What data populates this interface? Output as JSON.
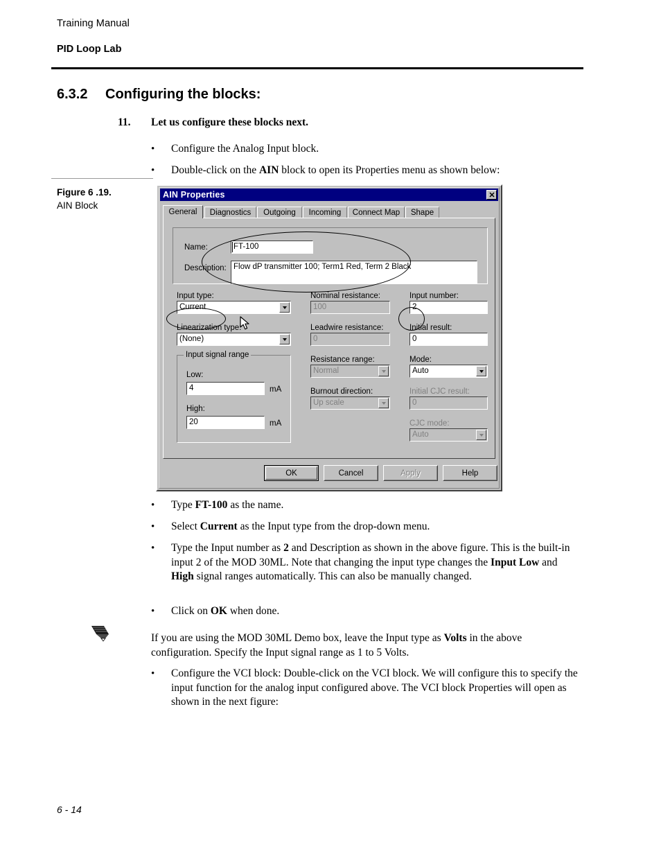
{
  "page": {
    "running_header": "Training Manual",
    "chapter_header": "PID Loop Lab",
    "footer_page_number": "6 - 14"
  },
  "section": {
    "number": "6.3.2",
    "title": "Configuring the blocks:"
  },
  "numbered_item": {
    "number": "11.",
    "text": "Let us configure these blocks next."
  },
  "bullets_above_figure": [
    "Configure the Analog Input block.",
    "Double-click on the AIN block to open its Properties menu as shown below:"
  ],
  "figure": {
    "label": "Figure 6 .19.",
    "caption": "AIN Block"
  },
  "dialog": {
    "title": "AIN Properties",
    "close_icon": "close-icon",
    "tabs": [
      {
        "label": "General",
        "active": true
      },
      {
        "label": "Diagnostics",
        "active": false
      },
      {
        "label": "Outgoing",
        "active": false
      },
      {
        "label": "Incoming",
        "active": false
      },
      {
        "label": "Connect Map",
        "active": false
      },
      {
        "label": "Shape",
        "active": false
      }
    ],
    "identity": {
      "name_label": "Name:",
      "name_value": "FT-100",
      "description_label": "Description:",
      "description_value": "Flow dP transmitter 100; Term1 Red, Term 2 Black"
    },
    "left_column": {
      "input_type_label": "Input type:",
      "input_type_value": "Current",
      "linearization_label": "Linearization type:",
      "linearization_value": "(None)",
      "signal_range_group": "Input signal range",
      "low_label": "Low:",
      "low_value": "4",
      "low_units": "mA",
      "high_label": "High:",
      "high_value": "20",
      "high_units": "mA"
    },
    "middle_column": {
      "nominal_resistance_label": "Nominal resistance:",
      "nominal_resistance_value": "100",
      "leadwire_resistance_label": "Leadwire resistance:",
      "leadwire_resistance_value": "0",
      "resistance_range_label": "Resistance range:",
      "resistance_range_value": "Normal",
      "burnout_direction_label": "Burnout direction:",
      "burnout_direction_value": "Up scale"
    },
    "right_column": {
      "input_number_label": "Input number:",
      "input_number_value": "2",
      "initial_result_label": "Initial result:",
      "initial_result_value": "0",
      "mode_label": "Mode:",
      "mode_value": "Auto",
      "initial_cjc_label": "Initial CJC result:",
      "initial_cjc_value": "0",
      "cjc_mode_label": "CJC mode:",
      "cjc_mode_value": "Auto"
    },
    "buttons": [
      {
        "label": "OK",
        "state": "default"
      },
      {
        "label": "Cancel",
        "state": "normal"
      },
      {
        "label": "Apply",
        "state": "disabled"
      },
      {
        "label": "Help",
        "state": "normal"
      }
    ]
  },
  "bullets_below_figure": {
    "b1_pre": "Type ",
    "b1_bold": "FT-100",
    "b1_post": " as the name.",
    "b2_pre": "Select ",
    "b2_bold": "Current",
    "b2_post": " as the Input type from the drop-down menu.",
    "b3_pre": "Type the Input number as ",
    "b3_bold1": "2",
    "b3_mid1": " and Description as shown in the above figure. This is the built-in input 2 of the MOD 30ML. Note that changing the input type changes the ",
    "b3_bold2": "Input Low",
    "b3_mid2": " and ",
    "b3_bold3": "High",
    "b3_post": " signal ranges automatically. This can also be manually changed.",
    "b4_pre": "Click on ",
    "b4_bold": "OK",
    "b4_post": " when done."
  },
  "note": {
    "icon": "pencil-icon",
    "pre": "If you are using the MOD 30ML Demo box, leave the Input type as ",
    "bold": "Volts",
    "post": " in the above configuration. Specify the Input signal range as 1 to 5 Volts."
  },
  "final_bullet": "Configure the VCI block: Double-click on the VCI block. We will configure this to specify the input function for the analog input configured above. The VCI block Properties will open as shown in the next figure:"
}
